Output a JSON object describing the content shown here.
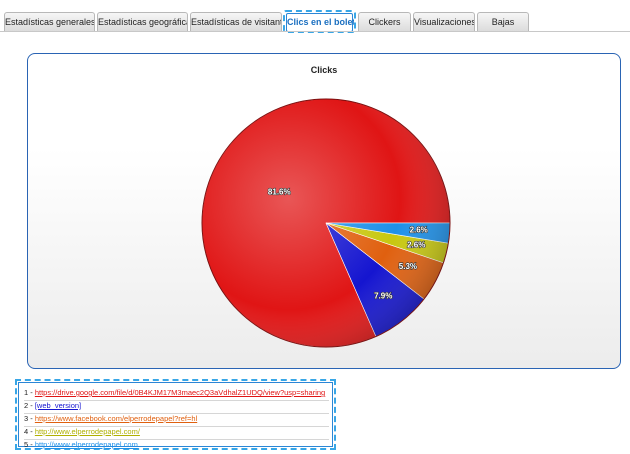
{
  "tabs": [
    {
      "label": "Estadísticas generales",
      "active": false
    },
    {
      "label": "Estadísticas geográficas",
      "active": false
    },
    {
      "label": "Estadísticas de visitantes",
      "active": false
    },
    {
      "label": "Clics en el boletín",
      "active": true
    },
    {
      "label": "Clickers",
      "active": false
    },
    {
      "label": "Visualizaciones",
      "active": false
    },
    {
      "label": "Bajas",
      "active": false
    }
  ],
  "chart_data": {
    "type": "pie",
    "title": "Clicks",
    "slices": [
      {
        "label": "81.6%",
        "value": 81.6,
        "color": "#e01515"
      },
      {
        "label": "7.9%",
        "value": 7.9,
        "color": "#1515d0"
      },
      {
        "label": "5.3%",
        "value": 5.3,
        "color": "#e0600f"
      },
      {
        "label": "2.6%",
        "value": 2.6,
        "color": "#c8c810"
      },
      {
        "label": "2.6%",
        "value": 2.6,
        "color": "#1e90e8"
      }
    ]
  },
  "links": [
    {
      "index": "1 - ",
      "url": "https://drive.google.com/file/d/0B4KJM17M3maec2Q3aVdhalZ1UDQ/view?usp=sharing",
      "color": "#e01515"
    },
    {
      "index": "2 - ",
      "url": "[web_version]",
      "color": "#1515d0"
    },
    {
      "index": "3 - ",
      "url": "https://www.facebook.com/elperrodepapel?ref=hl",
      "color": "#e0600f"
    },
    {
      "index": "4 - ",
      "url": "http://www.elperrodepapel.com/",
      "color": "#b0b000"
    },
    {
      "index": "5 - ",
      "url": "http://www.elperrodepapel.com",
      "color": "#1e90e8"
    }
  ]
}
